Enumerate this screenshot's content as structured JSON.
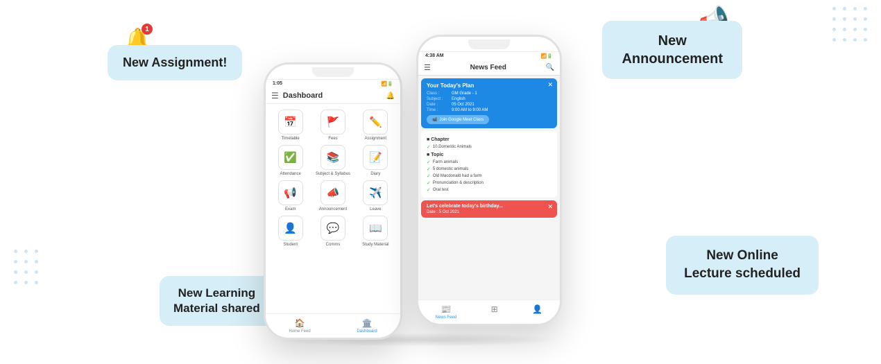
{
  "callouts": {
    "assignment": "New Assignment!",
    "announcement_line1": "New",
    "announcement_line2": "Announcement",
    "learning_line1": "New Learning",
    "learning_line2": "Material shared",
    "lecture_line1": "New Online",
    "lecture_line2": "Lecture scheduled"
  },
  "phone1": {
    "status_left": "1:05",
    "title": "Dashboard",
    "apps": [
      {
        "icon": "📅",
        "label": "Timetable"
      },
      {
        "icon": "🚩",
        "label": "Fees"
      },
      {
        "icon": "✏️",
        "label": "Assignment"
      },
      {
        "icon": "✅",
        "label": "Attendance"
      },
      {
        "icon": "📚",
        "label": "Subject & Syllabus"
      },
      {
        "icon": "📝",
        "label": "Diary"
      },
      {
        "icon": "📢",
        "label": "Exam"
      },
      {
        "icon": "📣",
        "label": "Announcement"
      },
      {
        "icon": "✈️",
        "label": "Leave"
      },
      {
        "icon": "👤",
        "label": "Student"
      },
      {
        "icon": "💬",
        "label": "Comms"
      },
      {
        "icon": "📖",
        "label": "Study Material"
      }
    ],
    "nav": [
      {
        "icon": "🏠",
        "label": "Home Feed"
      },
      {
        "icon": "🏛️",
        "label": "Dashboard",
        "active": true
      }
    ]
  },
  "phone2": {
    "status_left": "4:38 AM",
    "status_right": "⬆️⬇️ 📶 🔋",
    "title": "News Feed",
    "plan": {
      "title": "Your Today's Plan",
      "class": "GM Grade - 1",
      "subject": "English",
      "date": "05 Oct 2021",
      "time": "9:00 AM to 9:00 AM",
      "join_btn": "Join Google Meet Class"
    },
    "chapter_label": "Chapter",
    "chapter_item": "10.Domestic Animals",
    "topic_label": "Topic",
    "topics": [
      "Farm animals",
      "5 domestic animals",
      "Old Macdonald had a farm",
      "Pronunciation & description",
      "Oral test"
    ],
    "birthday": {
      "title": "Let's celebrate today's birthday...",
      "date": "Date : 5 Oct 2021"
    },
    "nav": [
      {
        "icon": "📰",
        "label": "News Feed"
      },
      {
        "icon": "⊞",
        "label": ""
      },
      {
        "icon": "👤",
        "label": ""
      }
    ]
  },
  "dots_count": 12
}
